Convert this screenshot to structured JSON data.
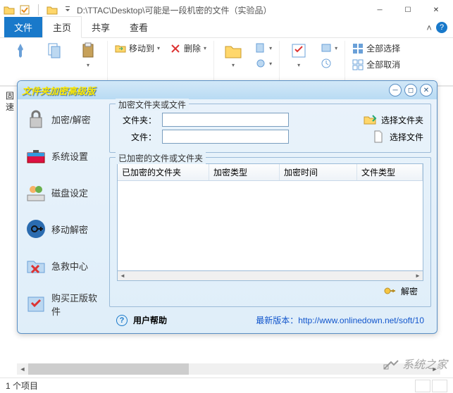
{
  "titlebar": {
    "path": "D:\\TTAC\\Desktop\\可能是一段机密的文件（实验品）"
  },
  "ribbon": {
    "tabs": {
      "file": "文件",
      "home": "主页",
      "share": "共享",
      "view": "查看"
    },
    "moveTo": "移动到",
    "delete": "删除",
    "selectAll": "全部选择",
    "selectNone": "全部取消"
  },
  "leftPane": {
    "line1": "固",
    "line2": "速"
  },
  "dialog": {
    "title": "文件夹加密高级版",
    "sidebar": {
      "encrypt": "加密/解密",
      "settings": "系统设置",
      "disk": "磁盘设定",
      "mobile": "移动解密",
      "rescue": "急救中心",
      "buy": "购买正版软件"
    },
    "group1": {
      "legend": "加密文件夹或文件",
      "folderLabel": "文件夹：",
      "fileLabel": "文件：",
      "selectFolder": "选择文件夹",
      "selectFile": "选择文件",
      "folderValue": "",
      "fileValue": ""
    },
    "group2": {
      "legend": "已加密的文件或文件夹",
      "cols": {
        "c1": "已加密的文件夹",
        "c2": "加密类型",
        "c3": "加密时间",
        "c4": "文件类型"
      }
    },
    "decrypt": "解密",
    "footer": {
      "help": "用户帮助",
      "versionLabel": "最新版本：",
      "versionLink": "http://www.onlinedown.net/soft/10"
    }
  },
  "status": {
    "items": "1 个项目"
  },
  "watermark": "系统之家"
}
